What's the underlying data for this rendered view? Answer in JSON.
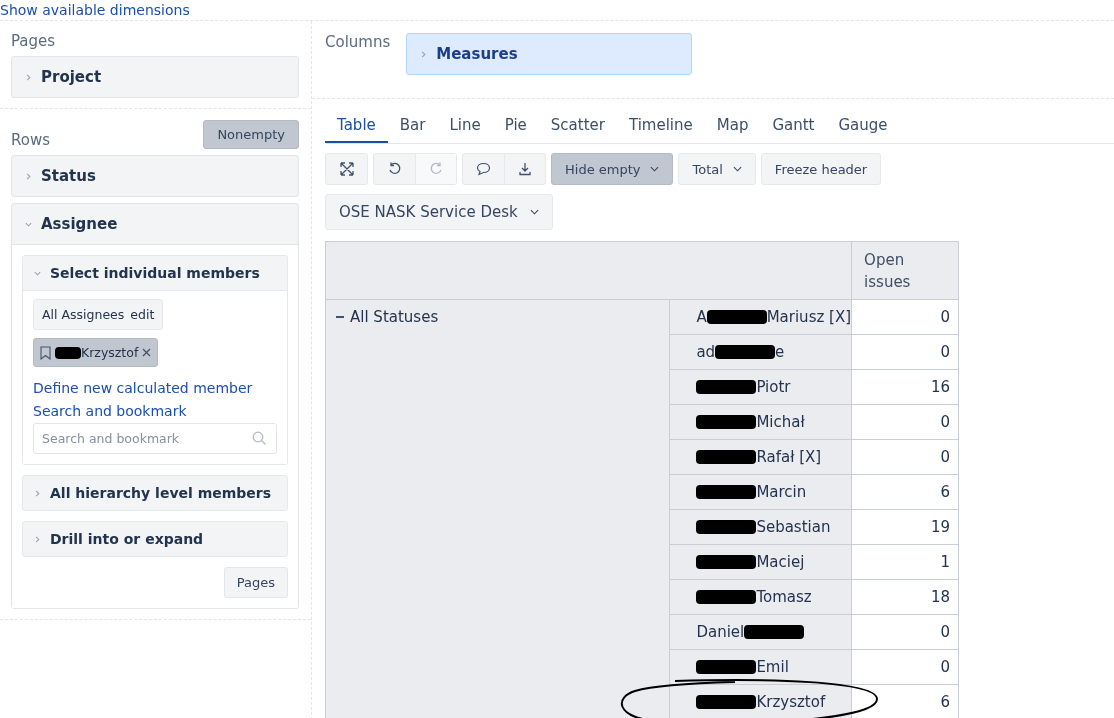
{
  "top_link": "Show available dimensions",
  "pages": {
    "title": "Pages",
    "items": [
      {
        "label": "Project",
        "expanded": false
      }
    ]
  },
  "rows": {
    "title": "Rows",
    "button": "Nonempty",
    "items": [
      {
        "label": "Status",
        "expanded": false
      },
      {
        "label": "Assignee",
        "expanded": true
      }
    ]
  },
  "assignee": {
    "sections": [
      {
        "label": "Select individual members",
        "expanded": true
      },
      {
        "label": "All hierarchy level members",
        "expanded": false
      },
      {
        "label": "Drill into or expand",
        "expanded": false
      }
    ],
    "all_members": "All Assignees",
    "edit": "edit",
    "chip": {
      "segments": [
        {
          "kind": "redaction"
        },
        {
          "kind": "text",
          "text": "Krzysztof"
        }
      ]
    },
    "links": [
      "Define new calculated member",
      "Search and bookmark"
    ],
    "search_placeholder": "Search and bookmark",
    "footer_button": "Pages"
  },
  "columns": {
    "title": "Columns",
    "item": "Measures"
  },
  "tabs": [
    {
      "label": "Table",
      "selected": true
    },
    {
      "label": "Bar",
      "selected": false
    },
    {
      "label": "Line",
      "selected": false
    },
    {
      "label": "Pie",
      "selected": false
    },
    {
      "label": "Scatter",
      "selected": false
    },
    {
      "label": "Timeline",
      "selected": false
    },
    {
      "label": "Map",
      "selected": false
    },
    {
      "label": "Gantt",
      "selected": false
    },
    {
      "label": "Gauge",
      "selected": false
    }
  ],
  "toolbar_groups": [
    [
      {
        "kind": "expand",
        "disabled": false
      }
    ],
    [
      {
        "kind": "undo",
        "disabled": false
      },
      {
        "kind": "redo",
        "disabled": true
      }
    ],
    [
      {
        "kind": "comment",
        "disabled": false
      },
      {
        "kind": "export",
        "disabled": false
      }
    ]
  ],
  "toolbar_buttons": [
    {
      "label": "Hide empty",
      "dropdown": true,
      "active": true
    },
    {
      "label": "Total",
      "dropdown": true,
      "active": false
    },
    {
      "label": "Freeze header",
      "dropdown": false,
      "active": false
    }
  ],
  "project_dropdown": "OSE NASK Service Desk",
  "table": {
    "header": "Open issues",
    "group": "All Statuses",
    "group_expanded": true,
    "rows": [
      {
        "segments": [
          {
            "kind": "text",
            "text": "A"
          },
          {
            "kind": "redaction"
          },
          {
            "kind": "text",
            "text": "Mariusz [X]"
          }
        ],
        "value": "0",
        "circled": false
      },
      {
        "segments": [
          {
            "kind": "text",
            "text": "ad"
          },
          {
            "kind": "redaction"
          },
          {
            "kind": "text",
            "text": "e"
          }
        ],
        "value": "0",
        "circled": false
      },
      {
        "segments": [
          {
            "kind": "redaction"
          },
          {
            "kind": "text",
            "text": "Piotr"
          }
        ],
        "value": "16",
        "circled": false
      },
      {
        "segments": [
          {
            "kind": "redaction"
          },
          {
            "kind": "text",
            "text": "Michał"
          }
        ],
        "value": "0",
        "circled": false
      },
      {
        "segments": [
          {
            "kind": "redaction"
          },
          {
            "kind": "text",
            "text": "Rafał [X]"
          }
        ],
        "value": "0",
        "circled": false
      },
      {
        "segments": [
          {
            "kind": "redaction"
          },
          {
            "kind": "text",
            "text": "Marcin"
          }
        ],
        "value": "6",
        "circled": false
      },
      {
        "segments": [
          {
            "kind": "redaction"
          },
          {
            "kind": "text",
            "text": "Sebastian"
          }
        ],
        "value": "19",
        "circled": false
      },
      {
        "segments": [
          {
            "kind": "redaction"
          },
          {
            "kind": "text",
            "text": "Maciej"
          }
        ],
        "value": "1",
        "circled": false
      },
      {
        "segments": [
          {
            "kind": "redaction"
          },
          {
            "kind": "text",
            "text": "Tomasz"
          }
        ],
        "value": "18",
        "circled": false
      },
      {
        "segments": [
          {
            "kind": "text",
            "text": "Daniel"
          },
          {
            "kind": "redaction"
          }
        ],
        "value": "0",
        "circled": false
      },
      {
        "segments": [
          {
            "kind": "redaction"
          },
          {
            "kind": "text",
            "text": "Emil"
          }
        ],
        "value": "0",
        "circled": false
      },
      {
        "segments": [
          {
            "kind": "redaction"
          },
          {
            "kind": "text",
            "text": "Krzysztof"
          }
        ],
        "value": "6",
        "circled": true
      }
    ]
  }
}
